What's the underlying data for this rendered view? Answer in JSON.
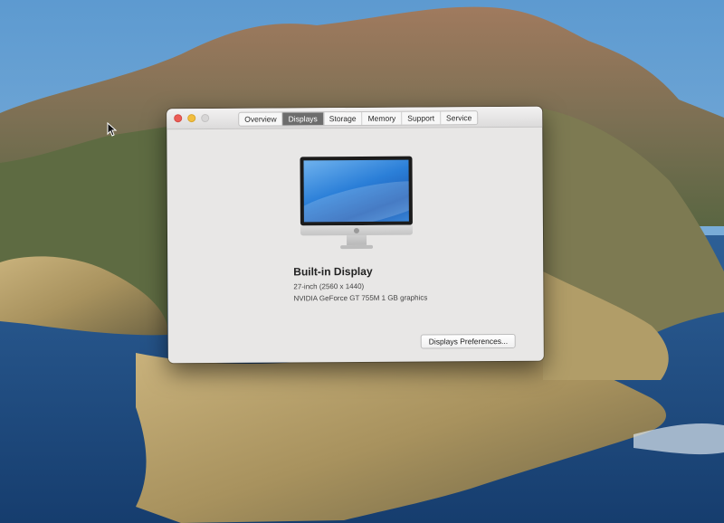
{
  "window": {
    "tabs": [
      "Overview",
      "Displays",
      "Storage",
      "Memory",
      "Support",
      "Service"
    ],
    "active_tab": "Displays",
    "display": {
      "name": "Built-in Display",
      "resolution": "27-inch (2560 x 1440)",
      "graphics": "NVIDIA GeForce GT 755M 1 GB graphics"
    },
    "prefs_button_label": "Displays Preferences..."
  },
  "icons": {
    "traffic_lights": [
      "close-icon",
      "minimize-icon",
      "zoom-icon"
    ],
    "cursor": "arrow-cursor-icon",
    "display_illustration": "imac-icon"
  },
  "colors": {
    "close": "#ec5d57",
    "minimize": "#f2be3e",
    "active_tab": "#6d6d6d"
  }
}
